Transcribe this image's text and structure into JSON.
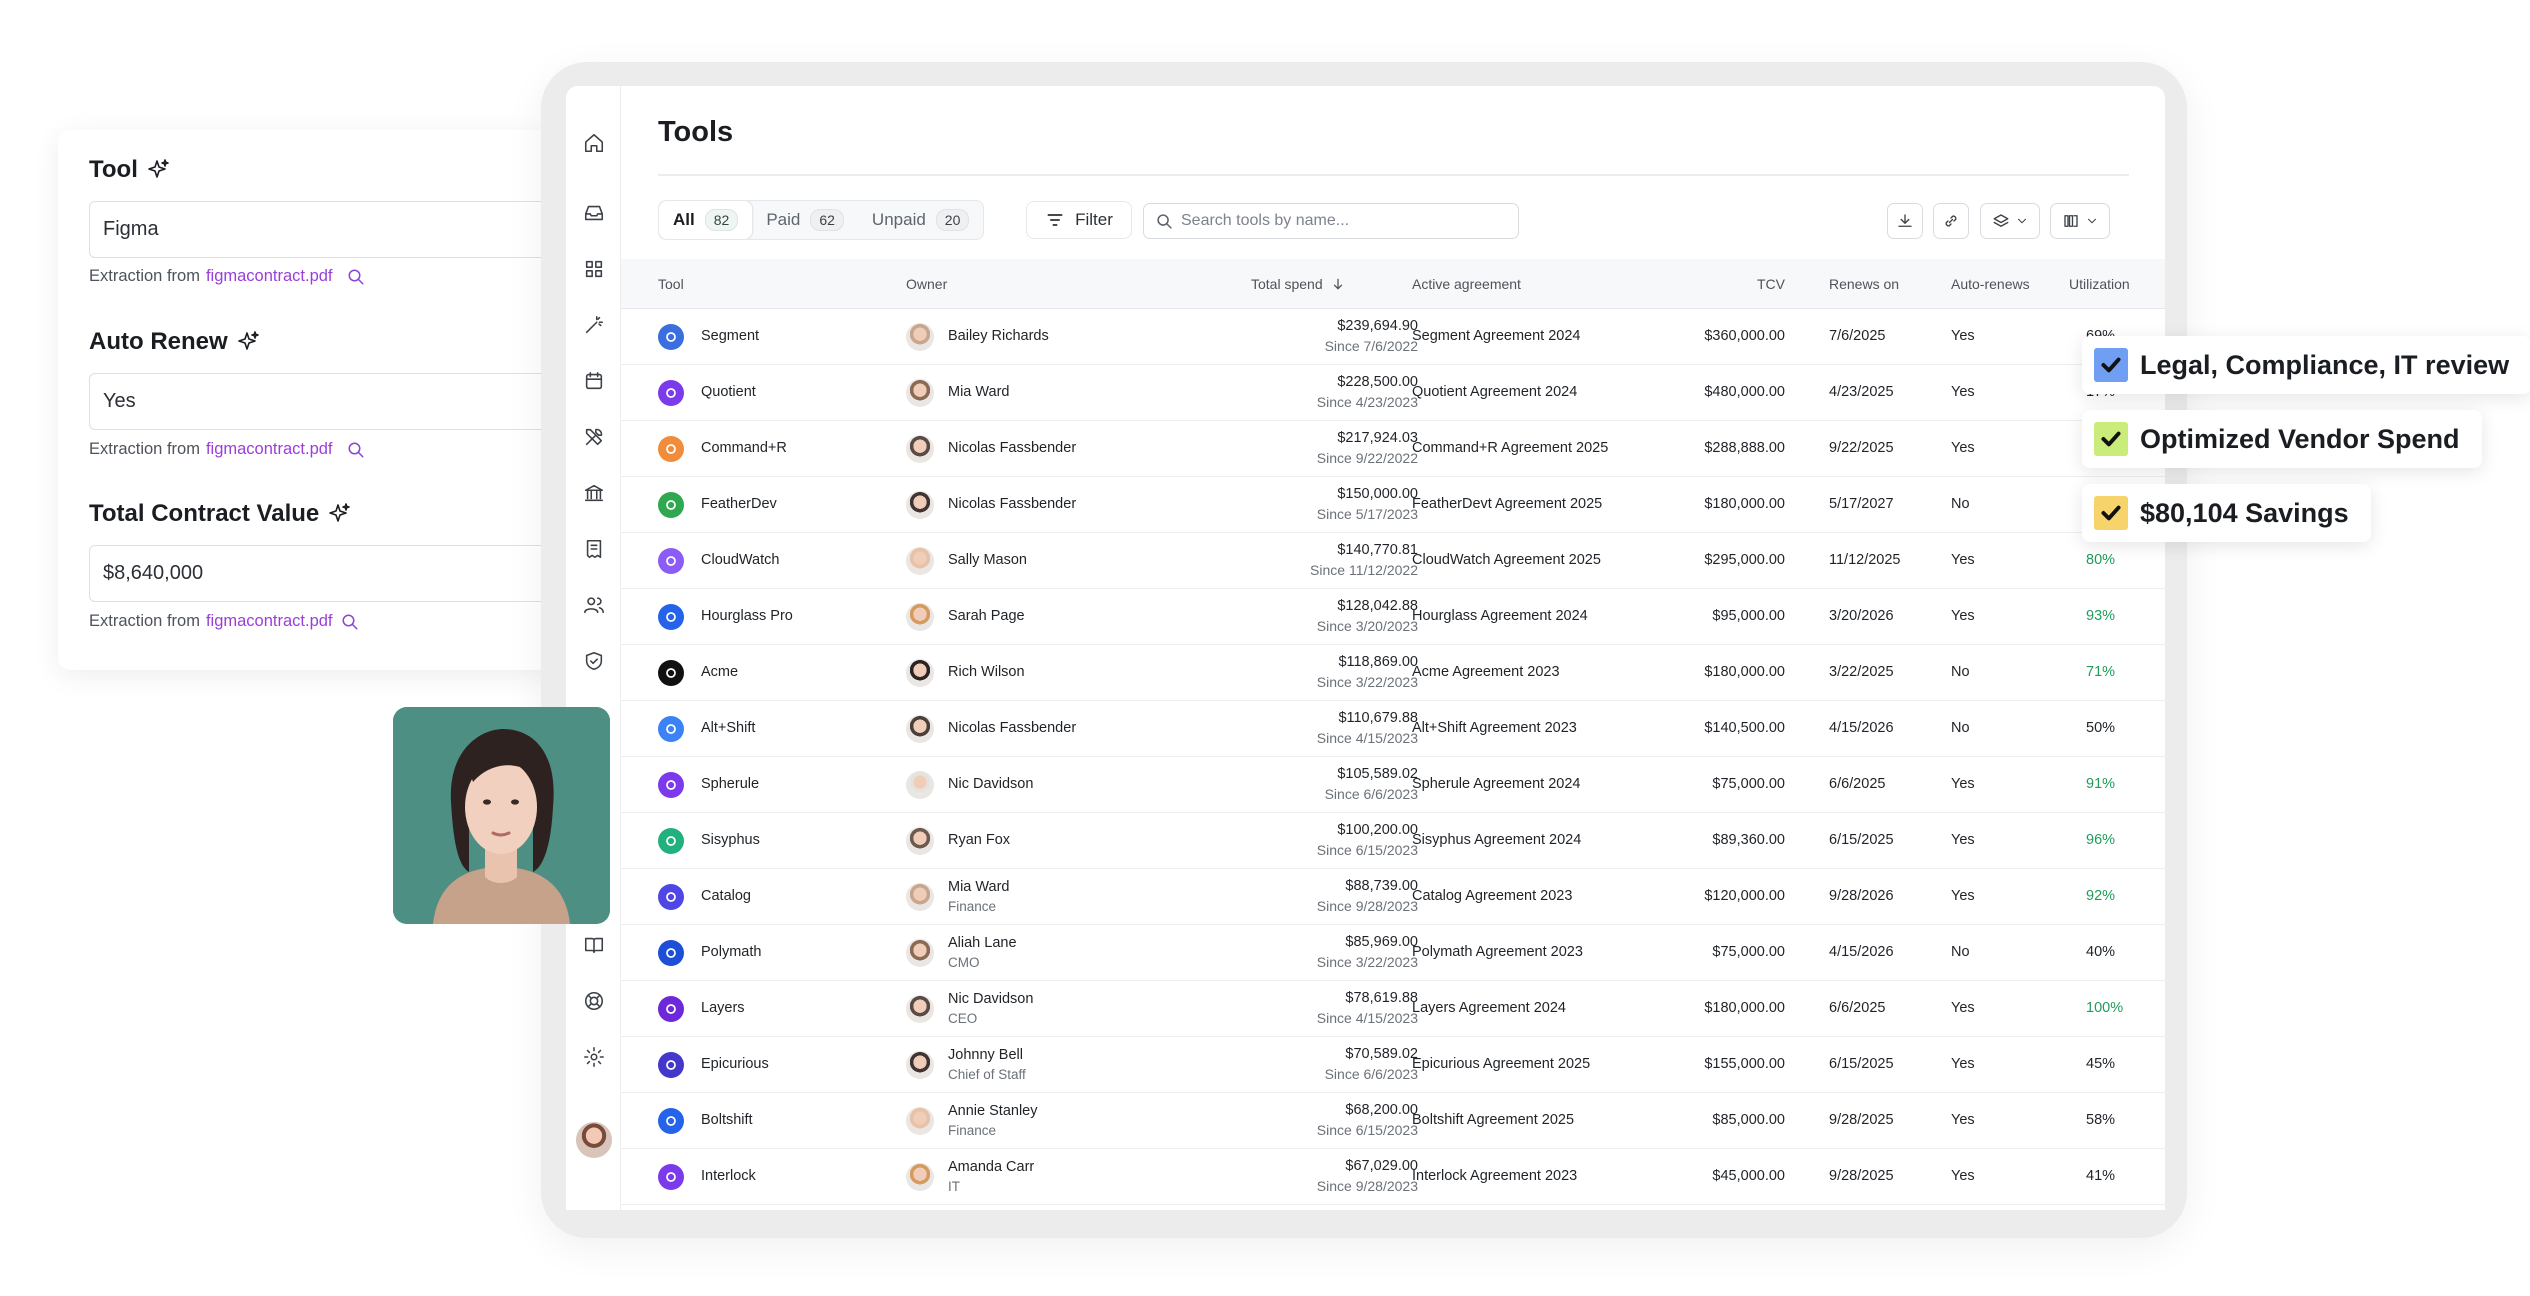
{
  "extraction": {
    "fields": [
      {
        "label": "Tool",
        "value": "Figma",
        "source_prefix": "Extraction from",
        "source_file": "figmacontract.pdf"
      },
      {
        "label": "Auto Renew",
        "value": "Yes",
        "source_prefix": "Extraction from",
        "source_file": "figmacontract.pdf"
      },
      {
        "label": "Total Contract Value",
        "value": "$8,640,000",
        "source_prefix": "Extraction from",
        "source_file": "figmacontract.pdf"
      }
    ]
  },
  "badges": [
    {
      "label": "Legal, Compliance, IT review",
      "color": "#6f9ef3"
    },
    {
      "label": "Optimized Vendor Spend",
      "color": "#c9ec7a"
    },
    {
      "label": "$80,104 Savings",
      "color": "#f6d36b"
    }
  ],
  "page": {
    "title": "Tools"
  },
  "segments": [
    {
      "label": "All",
      "count": "82",
      "active": true
    },
    {
      "label": "Paid",
      "count": "62",
      "active": false
    },
    {
      "label": "Unpaid",
      "count": "20",
      "active": false
    }
  ],
  "toolbar": {
    "filter_label": "Filter",
    "search_placeholder": "Search tools by name...",
    "search_value": ""
  },
  "columns": {
    "tool": "Tool",
    "owner": "Owner",
    "spend": "Total spend",
    "agreement": "Active agreement",
    "tcv": "TCV",
    "renews": "Renews on",
    "auto": "Auto-renews",
    "util": "Utilization"
  },
  "rows": [
    {
      "tool": "Segment",
      "logo_color": "#3b6fe0",
      "owner": "Bailey Richards",
      "role": "",
      "spend": "$239,694.90",
      "since": "Since 7/6/2022",
      "agreement": "Segment Agreement 2024",
      "tcv": "$360,000.00",
      "renews": "7/6/2025",
      "auto": "Yes",
      "util": "69%",
      "util_green": false
    },
    {
      "tool": "Quotient",
      "logo_color": "#7c3aed",
      "owner": "Mia Ward",
      "role": "",
      "spend": "$228,500.00",
      "since": "Since 4/23/2023",
      "agreement": "Quotient Agreement 2024",
      "tcv": "$480,000.00",
      "renews": "4/23/2025",
      "auto": "Yes",
      "util": "17%",
      "util_green": false
    },
    {
      "tool": "Command+R",
      "logo_color": "#f08c3a",
      "owner": "Nicolas Fassbender",
      "role": "",
      "spend": "$217,924.03",
      "since": "Since 9/22/2022",
      "agreement": "Command+R Agreement 2025",
      "tcv": "$288,888.00",
      "renews": "9/22/2025",
      "auto": "Yes",
      "util": "",
      "util_green": false
    },
    {
      "tool": "FeatherDev",
      "logo_color": "#2fa84f",
      "owner": "Nicolas Fassbender",
      "role": "",
      "spend": "$150,000.00",
      "since": "Since 5/17/2023",
      "agreement": "FeatherDevt Agreement 2025",
      "tcv": "$180,000.00",
      "renews": "5/17/2027",
      "auto": "No",
      "util": "",
      "util_green": false
    },
    {
      "tool": "CloudWatch",
      "logo_color": "#8b5cf6",
      "owner": "Sally Mason",
      "role": "",
      "spend": "$140,770.81",
      "since": "Since 11/12/2022",
      "agreement": "CloudWatch Agreement 2025",
      "tcv": "$295,000.00",
      "renews": "11/12/2025",
      "auto": "Yes",
      "util": "80%",
      "util_green": true
    },
    {
      "tool": "Hourglass Pro",
      "logo_color": "#2563eb",
      "owner": "Sarah Page",
      "role": "",
      "spend": "$128,042.88",
      "since": "Since 3/20/2023",
      "agreement": "Hourglass Agreement 2024",
      "tcv": "$95,000.00",
      "renews": "3/20/2026",
      "auto": "Yes",
      "util": "93%",
      "util_green": true
    },
    {
      "tool": "Acme",
      "logo_color": "#111111",
      "owner": "Rich Wilson",
      "role": "",
      "spend": "$118,869.00",
      "since": "Since 3/22/2023",
      "agreement": "Acme Agreement 2023",
      "tcv": "$180,000.00",
      "renews": "3/22/2025",
      "auto": "No",
      "util": "71%",
      "util_green": true
    },
    {
      "tool": "Alt+Shift",
      "logo_color": "#3b82f6",
      "owner": "Nicolas Fassbender",
      "role": "",
      "spend": "$110,679.88",
      "since": "Since 4/15/2023",
      "agreement": "Alt+Shift Agreement 2023",
      "tcv": "$140,500.00",
      "renews": "4/15/2026",
      "auto": "No",
      "util": "50%",
      "util_green": false
    },
    {
      "tool": "Spherule",
      "logo_color": "#7c3aed",
      "owner": "Nic Davidson",
      "role": "",
      "spend": "$105,589.02",
      "since": "Since 6/6/2023",
      "agreement": "Spherule Agreement 2024",
      "tcv": "$75,000.00",
      "renews": "6/6/2025",
      "auto": "Yes",
      "util": "91%",
      "util_green": true
    },
    {
      "tool": "Sisyphus",
      "logo_color": "#22b07d",
      "owner": "Ryan Fox",
      "role": "",
      "spend": "$100,200.00",
      "since": "Since 6/15/2023",
      "agreement": "Sisyphus Agreement 2024",
      "tcv": "$89,360.00",
      "renews": "6/15/2025",
      "auto": "Yes",
      "util": "96%",
      "util_green": true
    },
    {
      "tool": "Catalog",
      "logo_color": "#4f46e5",
      "owner": "Mia Ward",
      "role": "Finance",
      "spend": "$88,739.00",
      "since": "Since 9/28/2023",
      "agreement": "Catalog Agreement 2023",
      "tcv": "$120,000.00",
      "renews": "9/28/2026",
      "auto": "Yes",
      "util": "92%",
      "util_green": true
    },
    {
      "tool": "Polymath",
      "logo_color": "#1d4ed8",
      "owner": "Aliah Lane",
      "role": "CMO",
      "spend": "$85,969.00",
      "since": "Since 3/22/2023",
      "agreement": "Polymath Agreement 2023",
      "tcv": "$75,000.00",
      "renews": "4/15/2026",
      "auto": "No",
      "util": "40%",
      "util_green": false
    },
    {
      "tool": "Layers",
      "logo_color": "#6d28d9",
      "owner": "Nic Davidson",
      "role": "CEO",
      "spend": "$78,619.88",
      "since": "Since 4/15/2023",
      "agreement": "Layers Agreement 2024",
      "tcv": "$180,000.00",
      "renews": "6/6/2025",
      "auto": "Yes",
      "util": "100%",
      "util_green": true
    },
    {
      "tool": "Epicurious",
      "logo_color": "#4338ca",
      "owner": "Johnny Bell",
      "role": "Chief of Staff",
      "spend": "$70,589.02",
      "since": "Since 6/6/2023",
      "agreement": "Epicurious Agreement 2025",
      "tcv": "$155,000.00",
      "renews": "6/15/2025",
      "auto": "Yes",
      "util": "45%",
      "util_green": false
    },
    {
      "tool": "Boltshift",
      "logo_color": "#2563eb",
      "owner": "Annie Stanley",
      "role": "Finance",
      "spend": "$68,200.00",
      "since": "Since 6/15/2023",
      "agreement": "Boltshift Agreement 2025",
      "tcv": "$85,000.00",
      "renews": "9/28/2025",
      "auto": "Yes",
      "util": "58%",
      "util_green": false
    },
    {
      "tool": "Interlock",
      "logo_color": "#7c3aed",
      "owner": "Amanda Carr",
      "role": "IT",
      "spend": "$67,029.00",
      "since": "Since 9/28/2023",
      "agreement": "Interlock Agreement 2023",
      "tcv": "$45,000.00",
      "renews": "9/28/2025",
      "auto": "Yes",
      "util": "41%",
      "util_green": false
    }
  ]
}
